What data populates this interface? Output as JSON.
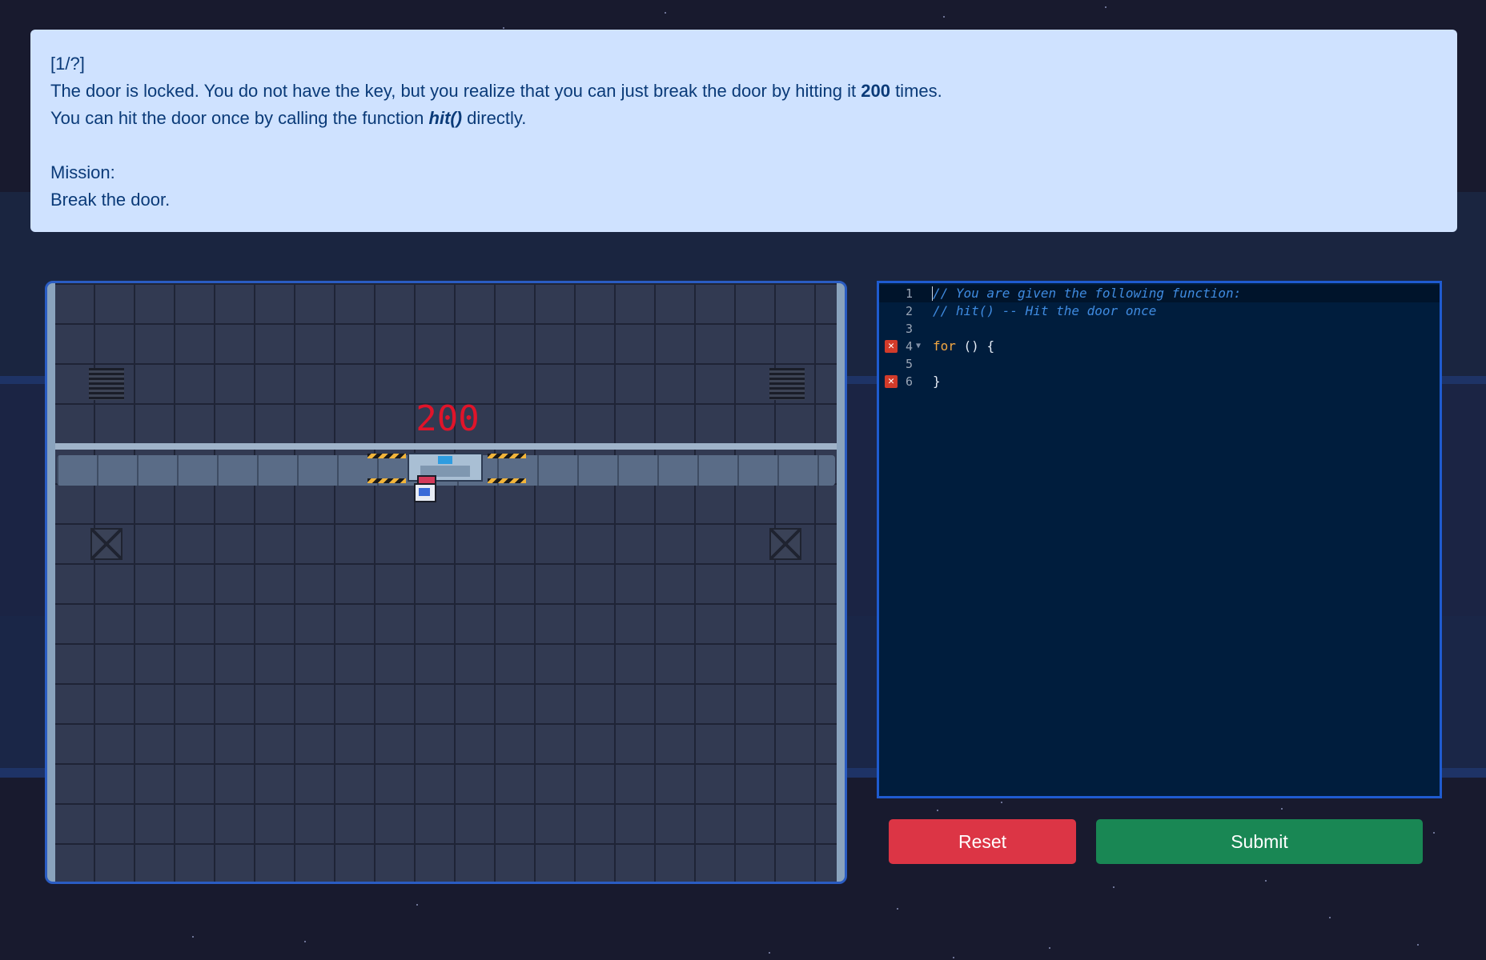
{
  "instructions": {
    "progress": "[1/?]",
    "line1_pre": "The door is locked. You do not have the key, but you realize that you can just break the door by hitting it ",
    "line1_count": "200",
    "line1_post": " times.",
    "line2_pre": "You can hit the door once by calling the function ",
    "line2_fn": "hit()",
    "line2_post": " directly.",
    "mission_label": "Mission:",
    "mission_text": "Break the door."
  },
  "game": {
    "door_hits_remaining": "200",
    "counter_color": "#e0142a"
  },
  "editor": {
    "lines": [
      {
        "number": "1",
        "text": "// You are given the following function:",
        "type": "comment",
        "error": false
      },
      {
        "number": "2",
        "text": "// hit() -- Hit the door once",
        "type": "comment",
        "error": false
      },
      {
        "number": "3",
        "text": "",
        "type": "code",
        "error": false
      },
      {
        "number": "4",
        "keyword": "for",
        "text": " () {",
        "type": "code",
        "error": true,
        "foldable": true
      },
      {
        "number": "5",
        "text": "",
        "type": "code",
        "error": false
      },
      {
        "number": "6",
        "text": "}",
        "type": "code",
        "error": true
      }
    ],
    "error_icon": "error-x-icon"
  },
  "buttons": {
    "reset": "Reset",
    "submit": "Submit",
    "reset_color": "#dc3545",
    "submit_color": "#198754"
  }
}
